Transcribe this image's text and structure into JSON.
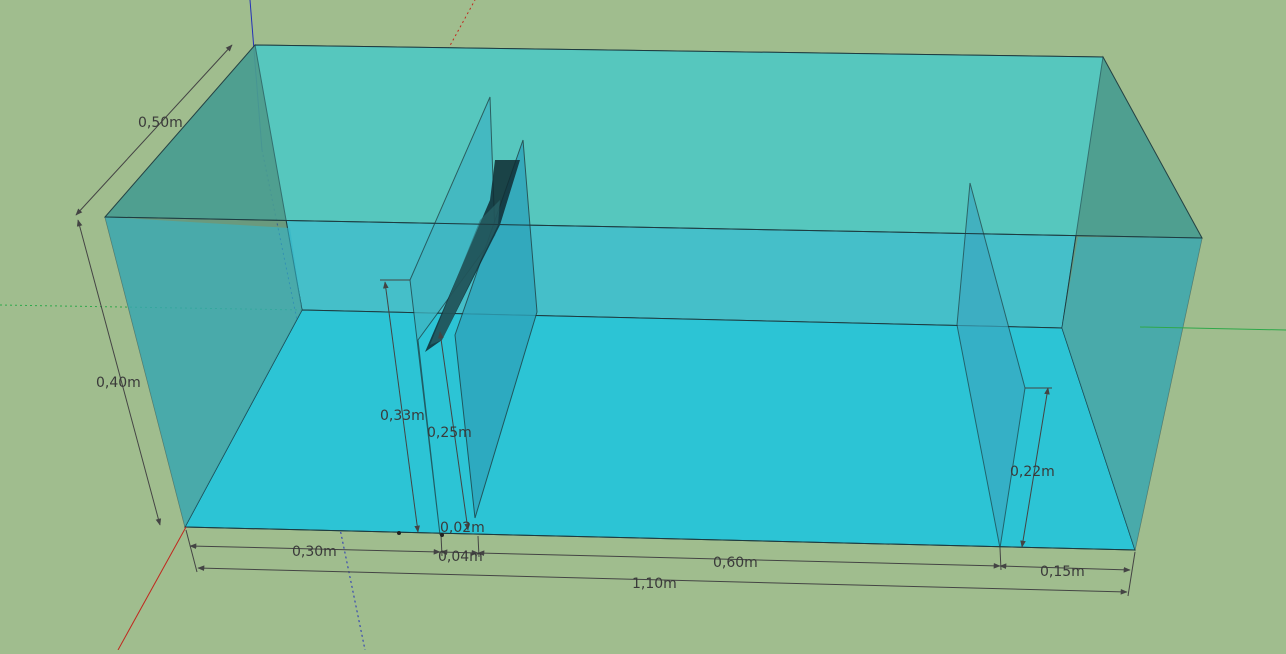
{
  "colors": {
    "background": "#a0bd8e",
    "water_face": "#33c7d9",
    "water_top": "#5ec5c0",
    "side_wall": "#3f7f72",
    "edge": "#1d3b40",
    "dimension": "#444444",
    "axis_red": "#c0281e",
    "axis_green": "#2fa84a",
    "axis_blue": "#2431b8",
    "mesh": "#111111"
  },
  "dimensions": {
    "depth": "0,50m",
    "height": "0,40m",
    "baffle_height": "0,33m",
    "inner_baffle_height": "0,25m",
    "gap_height": "0,02m",
    "left_section": "0,30m",
    "baffle_gap": "0,04m",
    "middle_section": "0,60m",
    "right_section": "0,15m",
    "total_length": "1,10m",
    "weir_height": "0,22m"
  }
}
